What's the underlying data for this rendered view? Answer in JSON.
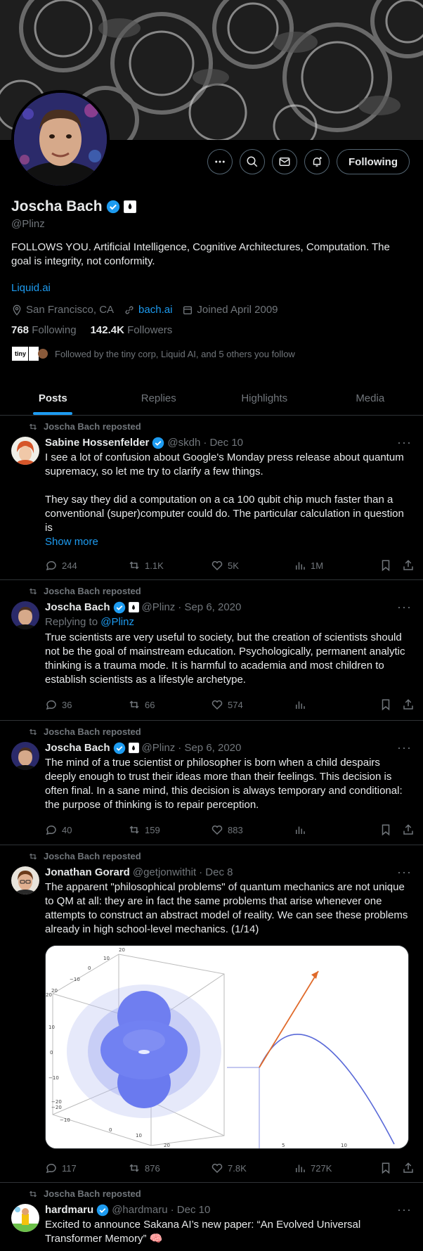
{
  "profile": {
    "name": "Joscha Bach",
    "handle": "@Plinz",
    "bio": "FOLLOWS YOU. Artificial Intelligence, Cognitive Architectures, Computation. The goal is integrity, not conformity.",
    "link": "Liquid.ai",
    "location": "San Francisco, CA",
    "website": "bach.ai",
    "joined": "Joined April 2009",
    "following_count": "768",
    "following_label": "Following",
    "followers_count": "142.4K",
    "followers_label": "Followers",
    "followed_by": "Followed by the tiny corp, Liquid AI, and 5 others you follow",
    "follow_button": "Following",
    "tiny_logo": "tiny"
  },
  "tabs": [
    {
      "label": "Posts",
      "active": true
    },
    {
      "label": "Replies"
    },
    {
      "label": "Highlights"
    },
    {
      "label": "Media"
    }
  ],
  "posts": [
    {
      "repost_label": "Joscha Bach reposted",
      "name": "Sabine Hossenfelder",
      "handle": "@skdh",
      "date": "· Dec 10",
      "text": "I see a lot of confusion about Google's Monday press release about quantum supremacy, so let me try to clarify a few things.\n\nThey say they did a computation on a ca 100 qubit chip much faster than a conventional (super)computer could do. The particular calculation in question is",
      "show_more": "Show more",
      "replies": "244",
      "reposts": "1.1K",
      "likes": "5K",
      "views": "1M"
    },
    {
      "repost_label": "Joscha Bach reposted",
      "name": "Joscha Bach",
      "handle": "@Plinz",
      "date": "· Sep 6, 2020",
      "replying_prefix": "Replying to",
      "replying_to": "@Plinz",
      "text": "True scientists are very useful to society, but the creation of scientists should not be the goal of mainstream education. Psychologically, permanent analytic thinking is a trauma mode. It is harmful to academia and most children to establish scientists as a lifestyle archetype.",
      "replies": "36",
      "reposts": "66",
      "likes": "574",
      "views": ""
    },
    {
      "repost_label": "Joscha Bach reposted",
      "name": "Joscha Bach",
      "handle": "@Plinz",
      "date": "· Sep 6, 2020",
      "text": "The mind of a true scientist or philosopher is born when a child despairs deeply enough to trust their ideas more than their feelings. This decision is often final. In a sane mind, this decision is always temporary and conditional: the purpose of thinking is to repair perception.",
      "replies": "40",
      "reposts": "159",
      "likes": "883",
      "views": ""
    },
    {
      "repost_label": "Joscha Bach reposted",
      "name": "Jonathan Gorard",
      "handle": "@getjonwithit",
      "date": "· Dec 8",
      "text": "The apparent \"philosophical problems\" of quantum mechanics are not unique to QM at all: they are in fact the same problems that arise whenever one attempts to construct an abstract model of reality. We can see these problems already in high school-level mechanics. (1/14)",
      "replies": "117",
      "reposts": "876",
      "likes": "7.8K",
      "views": "727K",
      "plot3d_ticks": {
        "top": [
          "20",
          "10",
          "0",
          "−10",
          "20"
        ],
        "left": [
          "20",
          "10",
          "0",
          "−10",
          "−20",
          "−20"
        ],
        "bottom": [
          "−10",
          "0",
          "10",
          "20"
        ]
      },
      "plot2d_ticks": [
        "5",
        "10"
      ]
    },
    {
      "repost_label": "Joscha Bach reposted",
      "name": "hardmaru",
      "handle": "@hardmaru",
      "date": "· Dec 10",
      "text": "Excited to announce Sakana AI’s new paper: “An Evolved Universal Transformer Memory” 🧠"
    }
  ],
  "colors": {
    "accent": "#1d9bf0",
    "muted": "#71767b",
    "bg": "#000000",
    "divider": "#2f3336"
  }
}
